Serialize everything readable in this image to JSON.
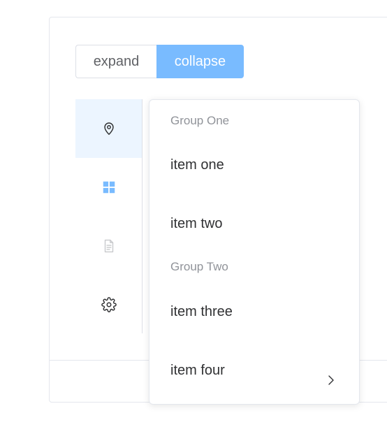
{
  "buttons": {
    "expand_label": "expand",
    "collapse_label": "collapse",
    "collapse_active": true
  },
  "sidebar": {
    "items": [
      {
        "icon": "location-icon",
        "active": true
      },
      {
        "icon": "grid-menu-icon",
        "active": false
      },
      {
        "icon": "document-icon",
        "active": false,
        "disabled": true
      },
      {
        "icon": "gear-icon",
        "active": false
      }
    ]
  },
  "popup": {
    "group_one_title": "Group One",
    "item_one": "item one",
    "item_two": "item two",
    "group_two_title": "Group Two",
    "item_three": "item three",
    "item_four": "item four"
  },
  "colors": {
    "primary_light": "#79bbff",
    "active_bg": "#ecf5ff",
    "text_primary": "#303133",
    "text_secondary": "#909399",
    "border": "#dcdfe6"
  }
}
